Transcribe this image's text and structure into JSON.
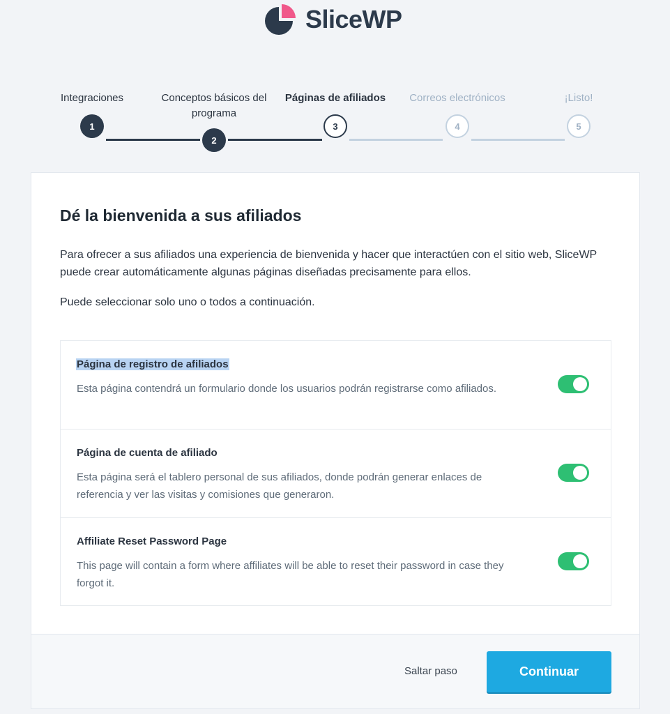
{
  "brand": {
    "name": "SliceWP",
    "accent": "#f0588a",
    "dark": "#2c3a4b"
  },
  "steps": [
    {
      "label": "Integraciones",
      "number": "1",
      "state": "done"
    },
    {
      "label": "Conceptos básicos del programa",
      "number": "2",
      "state": "done"
    },
    {
      "label": "Páginas de afiliados",
      "number": "3",
      "state": "current"
    },
    {
      "label": "Correos electrónicos",
      "number": "4",
      "state": "pending"
    },
    {
      "label": "¡Listo!",
      "number": "5",
      "state": "pending"
    }
  ],
  "main": {
    "title": "Dé la bienvenida a sus afiliados",
    "description": "Para ofrecer a sus afiliados una experiencia de bienvenida y hacer que interactúen con el sitio web, SliceWP puede crear automáticamente algunas páginas diseñadas precisamente para ellos.",
    "subtext": "Puede seleccionar solo uno o todos a continuación."
  },
  "options": [
    {
      "title": "Página de registro de afiliados",
      "description": "Esta página contendrá un formulario donde los usuarios podrán registrarse como afiliados.",
      "enabled": true
    },
    {
      "title": "Página de cuenta de afiliado",
      "description": "Esta página será el tablero personal de sus afiliados, donde podrán generar enlaces de referencia y ver las visitas y comisiones que generaron.",
      "enabled": true
    },
    {
      "title": "Affiliate Reset Password Page",
      "description": "This page will contain a form where affiliates will be able to reset their password in case they forgot it.",
      "enabled": true
    }
  ],
  "footer": {
    "skip_label": "Saltar paso",
    "continue_label": "Continuar"
  },
  "colors": {
    "toggle_on": "#2ebf73",
    "continue_button": "#1ea9e1",
    "page_background": "#f2f4f7"
  }
}
